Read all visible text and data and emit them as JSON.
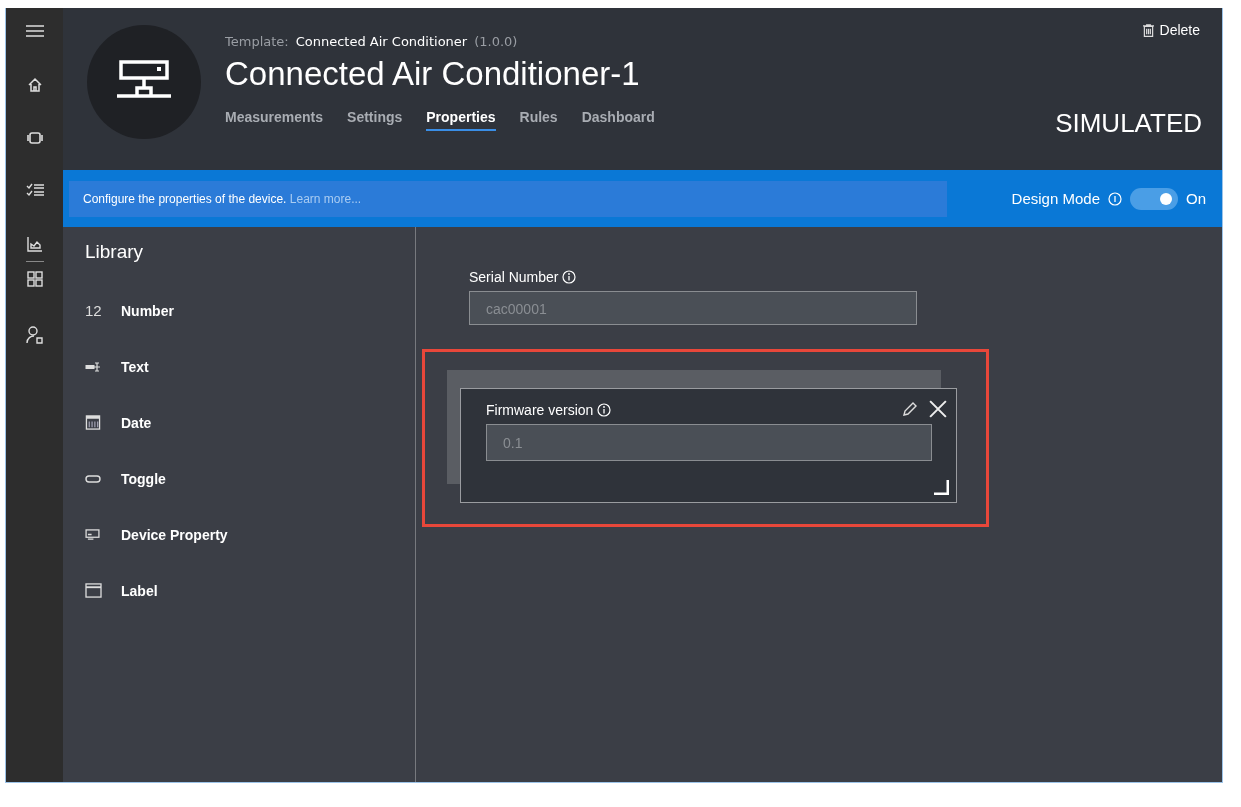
{
  "header": {
    "template_label": "Template:",
    "template_name": "Connected Air Conditioner",
    "template_version": "(1.0.0)",
    "title": "Connected Air Conditioner-1",
    "delete": "Delete",
    "status": "SIMULATED"
  },
  "tabs": [
    {
      "label": "Measurements",
      "selected": false
    },
    {
      "label": "Settings",
      "selected": false
    },
    {
      "label": "Properties",
      "selected": true
    },
    {
      "label": "Rules",
      "selected": false
    },
    {
      "label": "Dashboard",
      "selected": false
    }
  ],
  "banner": {
    "text": "Configure the properties of the device.",
    "link": "Learn more...",
    "design_mode_label": "Design Mode",
    "toggle_on": true,
    "toggle_text": "On"
  },
  "library": {
    "title": "Library",
    "items": [
      {
        "kind": "number",
        "icon_text": "12",
        "label": "Number"
      },
      {
        "kind": "text",
        "label": "Text"
      },
      {
        "kind": "date",
        "label": "Date"
      },
      {
        "kind": "toggle",
        "label": "Toggle"
      },
      {
        "kind": "device",
        "label": "Device Property"
      },
      {
        "kind": "label",
        "label": "Label"
      }
    ]
  },
  "fields": [
    {
      "label": "Serial Number",
      "value": "cac00001",
      "editing": false
    },
    {
      "label": "Firmware version",
      "value": "0.1",
      "editing": true
    }
  ]
}
